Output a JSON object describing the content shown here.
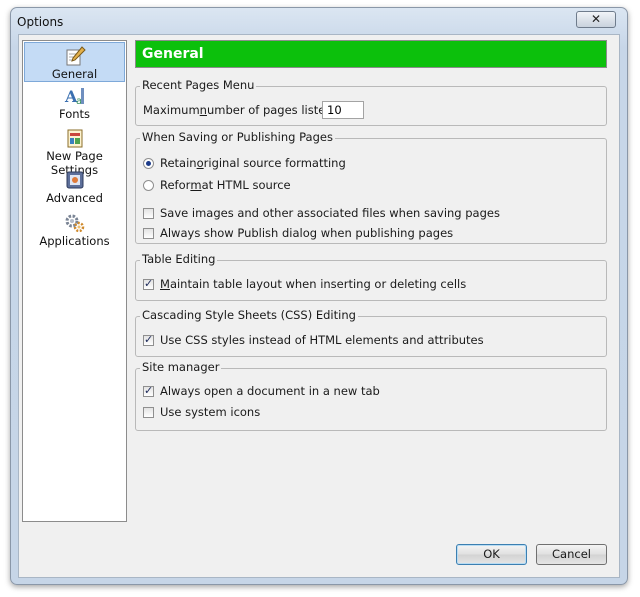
{
  "window": {
    "title": "Options",
    "close_glyph": "✕"
  },
  "sidebar": {
    "items": [
      {
        "label": "General",
        "icon": "pen-paper-icon",
        "selected": true
      },
      {
        "label": "Fonts",
        "icon": "fonts-icon",
        "selected": false
      },
      {
        "label": "New Page Settings",
        "icon": "new-page-icon",
        "selected": false
      },
      {
        "label": "Advanced",
        "icon": "advanced-icon",
        "selected": false
      },
      {
        "label": "Applications",
        "icon": "gears-icon",
        "selected": false
      }
    ]
  },
  "header": {
    "title": "General",
    "color": "#0cc00c"
  },
  "recent_pages": {
    "legend": "Recent Pages Menu",
    "label_pre": "Maximum ",
    "label_ul": "n",
    "label_post": "umber of pages listed:",
    "value": "10"
  },
  "saving": {
    "legend": "When Saving or Publishing Pages",
    "retain": {
      "pre": "Retain ",
      "ul": "o",
      "post": "riginal source formatting",
      "checked": true
    },
    "reformat": {
      "pre": "Refor",
      "ul": "m",
      "post": "at HTML source",
      "checked": false
    },
    "save_images": {
      "label": "Save images and other associated files when saving pages",
      "checked": false
    },
    "publish_dialog": {
      "label": "Always show Publish dialog when publishing pages",
      "checked": false
    }
  },
  "table_editing": {
    "legend": "Table Editing",
    "maintain": {
      "pre": "",
      "ul": "M",
      "post": "aintain table layout when inserting or deleting cells",
      "checked": true
    }
  },
  "css_editing": {
    "legend": "Cascading Style Sheets (CSS) Editing",
    "use_css": {
      "label": "Use CSS styles instead of HTML elements and attributes",
      "checked": true
    }
  },
  "site_manager": {
    "legend": "Site manager",
    "new_tab": {
      "label": "Always open a document in a new tab",
      "checked": true
    },
    "system_icons": {
      "label": "Use system icons",
      "checked": false
    }
  },
  "buttons": {
    "ok": "OK",
    "cancel": "Cancel"
  }
}
